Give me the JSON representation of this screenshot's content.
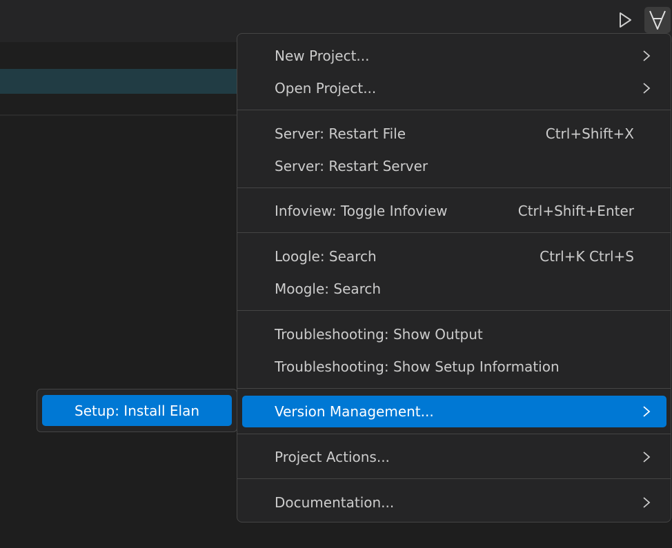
{
  "toolbar": {
    "run_icon": "play-icon",
    "lean_icon": "forall-icon"
  },
  "menu": {
    "items": [
      {
        "label": "New Project...",
        "shortcut": "",
        "submenu": true
      },
      {
        "label": "Open Project...",
        "shortcut": "",
        "submenu": true
      },
      {
        "label": "Server: Restart File",
        "shortcut": "Ctrl+Shift+X",
        "submenu": false
      },
      {
        "label": "Server: Restart Server",
        "shortcut": "",
        "submenu": false
      },
      {
        "label": "Infoview: Toggle Infoview",
        "shortcut": "Ctrl+Shift+Enter",
        "submenu": false
      },
      {
        "label": "Loogle: Search",
        "shortcut": "Ctrl+K Ctrl+S",
        "submenu": false
      },
      {
        "label": "Moogle: Search",
        "shortcut": "",
        "submenu": false
      },
      {
        "label": "Troubleshooting: Show Output",
        "shortcut": "",
        "submenu": false
      },
      {
        "label": "Troubleshooting: Show Setup Information",
        "shortcut": "",
        "submenu": false
      },
      {
        "label": "Version Management...",
        "shortcut": "",
        "submenu": true,
        "active": true
      },
      {
        "label": "Project Actions...",
        "shortcut": "",
        "submenu": true
      },
      {
        "label": "Documentation...",
        "shortcut": "",
        "submenu": true
      }
    ]
  },
  "submenu": {
    "items": [
      {
        "label": "Setup: Install Elan",
        "active": true
      }
    ]
  },
  "colors": {
    "accent": "#0078d4",
    "menu_bg": "#252526",
    "border": "#454545",
    "text": "#cccccc"
  }
}
